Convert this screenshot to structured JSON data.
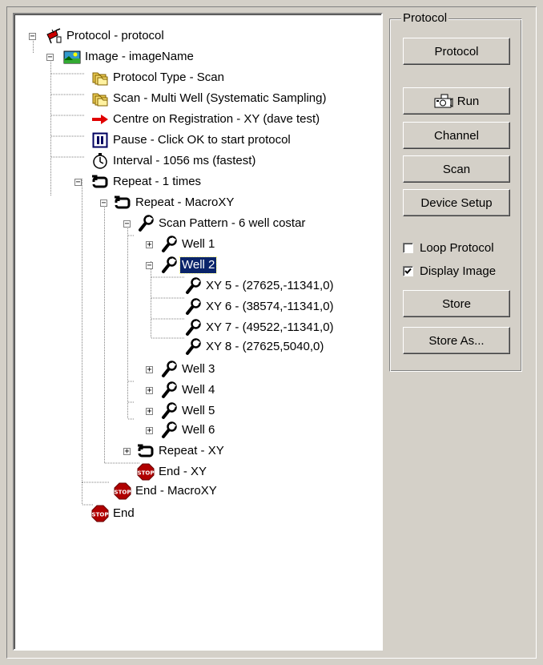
{
  "tree": {
    "nodes": [
      {
        "label": "Protocol - protocol",
        "icon": "protocol-icon",
        "toggle": "minus"
      },
      {
        "label": "Image - imageName",
        "icon": "image-icon",
        "toggle": "minus"
      },
      {
        "label": "Protocol Type - Scan",
        "icon": "folders-icon"
      },
      {
        "label": "Scan - Multi Well (Systematic Sampling)",
        "icon": "folders-icon"
      },
      {
        "label": "Centre on Registration - XY (dave test)",
        "icon": "red-arrow-icon"
      },
      {
        "label": "Pause - Click OK to start protocol",
        "icon": "pause-icon"
      },
      {
        "label": "Interval - 1056 ms (fastest)",
        "icon": "stopwatch-icon"
      },
      {
        "label": "Repeat - 1 times",
        "icon": "repeat-icon",
        "toggle": "minus"
      },
      {
        "label": "Repeat - MacroXY",
        "icon": "repeat-icon",
        "toggle": "minus"
      },
      {
        "label": "Scan Pattern - 6 well costar",
        "icon": "wrench-icon",
        "toggle": "minus"
      },
      {
        "label": "Well 1",
        "icon": "wrench-icon",
        "toggle": "plus"
      },
      {
        "label": "Well 2",
        "icon": "wrench-icon",
        "toggle": "minus",
        "selected": true
      },
      {
        "label": "XY 5 - (27625,-11341,0)",
        "icon": "wrench-icon"
      },
      {
        "label": "XY 6 - (38574,-11341,0)",
        "icon": "wrench-icon"
      },
      {
        "label": "XY 7 - (49522,-11341,0)",
        "icon": "wrench-icon"
      },
      {
        "label": "XY 8 - (27625,5040,0)",
        "icon": "wrench-icon"
      },
      {
        "label": "Well 3",
        "icon": "wrench-icon",
        "toggle": "plus"
      },
      {
        "label": "Well 4",
        "icon": "wrench-icon",
        "toggle": "plus"
      },
      {
        "label": "Well 5",
        "icon": "wrench-icon",
        "toggle": "plus"
      },
      {
        "label": "Well 6",
        "icon": "wrench-icon",
        "toggle": "plus"
      },
      {
        "label": "Repeat - XY",
        "icon": "repeat-icon",
        "toggle": "plus"
      },
      {
        "label": "End - XY",
        "icon": "stop-icon"
      },
      {
        "label": "End - MacroXY",
        "icon": "stop-icon"
      },
      {
        "label": "End",
        "icon": "stop-icon"
      }
    ]
  },
  "panel": {
    "title": "Protocol",
    "protocol_button": "Protocol",
    "run_button": "Run",
    "channel_button": "Channel",
    "scan_button": "Scan",
    "device_setup_button": "Device Setup",
    "loop_protocol": {
      "label": "Loop Protocol",
      "checked": false
    },
    "display_image": {
      "label": "Display Image",
      "checked": true
    },
    "store_button": "Store",
    "store_as_button": "Store As..."
  }
}
